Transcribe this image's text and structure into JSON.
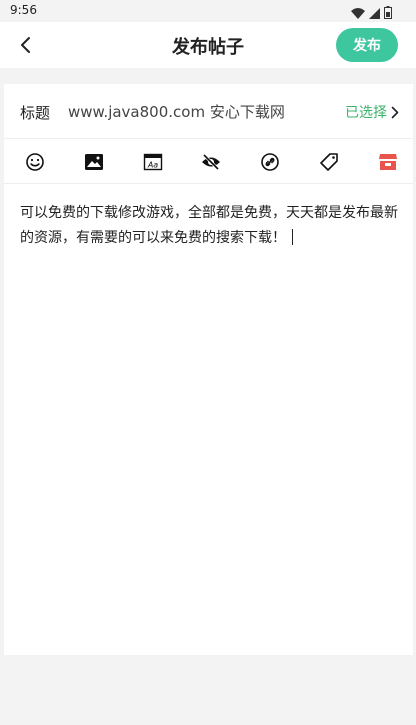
{
  "status": {
    "time": "9:56"
  },
  "header": {
    "title": "发布帖子",
    "publish_label": "发布"
  },
  "form": {
    "title_label": "标题",
    "title_value": "www.java800.com 安心下载网",
    "selected_label": "已选择"
  },
  "toolbar": {
    "items": [
      "emoji-icon",
      "image-icon",
      "font-icon",
      "hidden-icon",
      "link-icon",
      "tag-icon",
      "store-icon"
    ]
  },
  "editor": {
    "content": "可以免费的下载修改游戏，全部都是免费，天天都是发布最新的资源，有需要的可以来免费的搜索下载！"
  },
  "colors": {
    "accent": "#3ec69f",
    "link": "#3db36a",
    "store": "#e9554c"
  }
}
